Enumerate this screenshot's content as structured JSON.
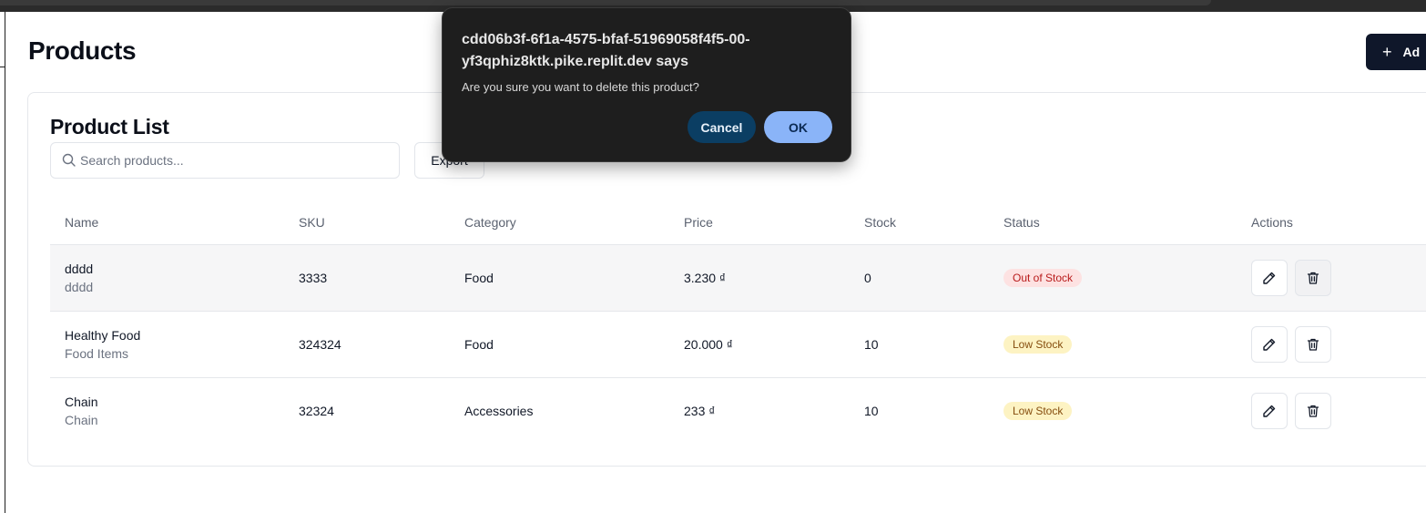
{
  "page": {
    "title": "Products",
    "add_button_label": "Ad"
  },
  "card": {
    "title": "Product List",
    "search_placeholder": "Search products...",
    "export_label": "Export"
  },
  "table": {
    "headers": [
      "Name",
      "SKU",
      "Category",
      "Price",
      "Stock",
      "Status",
      "Actions"
    ],
    "rows": [
      {
        "name": "dddd",
        "subtitle": "dddd",
        "sku": "3333",
        "category": "Food",
        "price": "3.230 ₫",
        "stock": "0",
        "status": "Out of Stock",
        "status_kind": "out"
      },
      {
        "name": "Healthy Food",
        "subtitle": "Food Items",
        "sku": "324324",
        "category": "Food",
        "price": "20.000 ₫",
        "stock": "10",
        "status": "Low Stock",
        "status_kind": "low"
      },
      {
        "name": "Chain",
        "subtitle": "Chain",
        "sku": "32324",
        "category": "Accessories",
        "price": "233 ₫",
        "stock": "10",
        "status": "Low Stock",
        "status_kind": "low"
      }
    ]
  },
  "dialog": {
    "title": "cdd06b3f-6f1a-4575-bfaf-51969058f4f5-00-yf3qphiz8ktk.pike.replit.dev says",
    "message": "Are you sure you want to delete this product?",
    "cancel_label": "Cancel",
    "ok_label": "OK"
  },
  "colors": {
    "primary": "#0f172a",
    "dialog_bg": "#1e1e1e",
    "dialog_ok": "#8ab4f8",
    "dialog_cancel": "#0b3e63",
    "badge_out_bg": "#fde2e2",
    "badge_low_bg": "#fdf3c3"
  },
  "icons": {
    "search": "search-icon",
    "plus": "plus-icon",
    "edit": "pencil-icon",
    "delete": "trash-icon"
  }
}
